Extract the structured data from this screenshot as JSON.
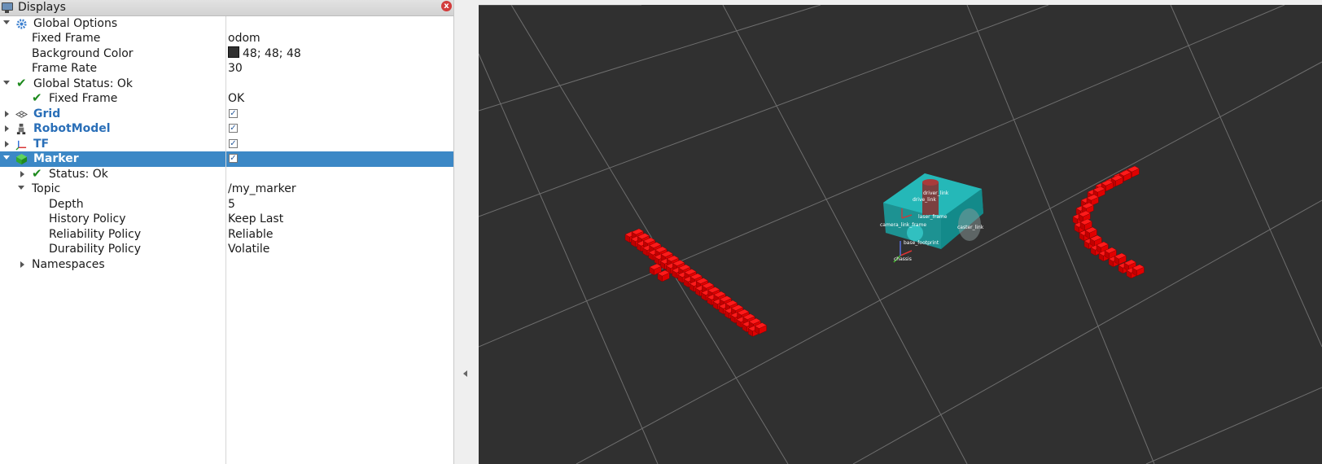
{
  "panel": {
    "title": "Displays",
    "close_label": "x"
  },
  "tree": {
    "global_options": {
      "label": "Global Options"
    },
    "fixed_frame": {
      "label": "Fixed Frame",
      "value": "odom"
    },
    "background_color": {
      "label": "Background Color",
      "value": "48; 48; 48",
      "swatch": "#303030"
    },
    "frame_rate": {
      "label": "Frame Rate",
      "value": "30"
    },
    "global_status": {
      "label": "Global Status: Ok"
    },
    "status_fixed_frame": {
      "label": "Fixed Frame",
      "value": "OK"
    },
    "grid": {
      "label": "Grid",
      "checked": true
    },
    "robot_model": {
      "label": "RobotModel",
      "checked": true
    },
    "tf": {
      "label": "TF",
      "checked": true
    },
    "marker": {
      "label": "Marker",
      "checked": true
    },
    "marker_status": {
      "label": "Status: Ok"
    },
    "topic": {
      "label": "Topic",
      "value": "/my_marker"
    },
    "depth": {
      "label": "Depth",
      "value": "5"
    },
    "history_policy": {
      "label": "History Policy",
      "value": "Keep Last"
    },
    "reliability_policy": {
      "label": "Reliability Policy",
      "value": "Reliable"
    },
    "durability_policy": {
      "label": "Durability Policy",
      "value": "Volatile"
    },
    "namespaces": {
      "label": "Namespaces"
    }
  },
  "viewport": {
    "background": "#303030",
    "grid_color": "#6e6e6e",
    "marker_color": "#e00000",
    "robot_body_color": "#1aa3a3",
    "robot_labels": [
      "drive_link",
      "camera_link_frame",
      "base_footprint",
      "chassis",
      "driver_link",
      "laser_frame",
      "caster_link"
    ]
  }
}
